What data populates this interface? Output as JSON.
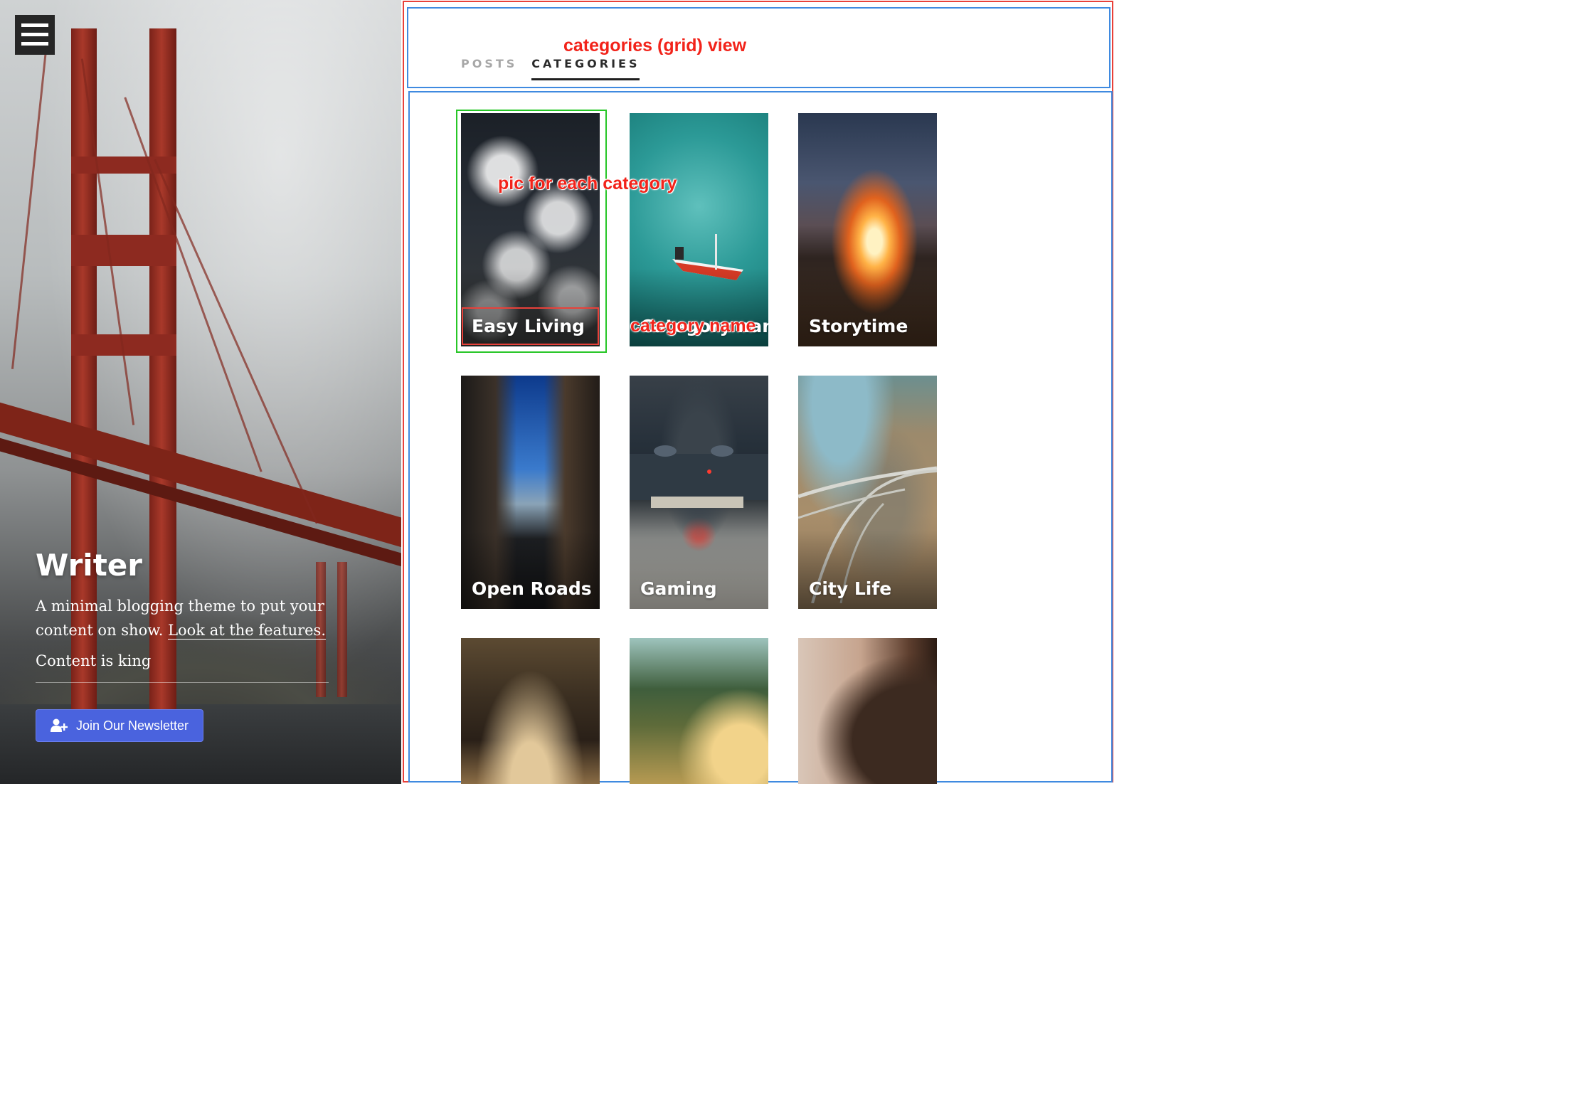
{
  "hero": {
    "title": "Writer",
    "description": "A minimal blogging theme to put your content on show.",
    "features_link": "Look at the features.",
    "tagline": "Content is king",
    "newsletter_button": "Join Our Newsletter"
  },
  "tabs": [
    {
      "label": "POSTS",
      "active": false
    },
    {
      "label": "CATEGORIES",
      "active": true
    }
  ],
  "annotations": {
    "view": "categories (grid) view",
    "pic": "pic for each category",
    "name": "category name"
  },
  "categories": [
    {
      "name": "Easy Living"
    },
    {
      "name": "Category name"
    },
    {
      "name": "Storytime"
    },
    {
      "name": "Open Roads"
    },
    {
      "name": "Gaming"
    },
    {
      "name": "City Life"
    },
    {
      "name": ""
    },
    {
      "name": ""
    },
    {
      "name": ""
    }
  ],
  "colors": {
    "newsletter_button": "#4a63de",
    "annotation_red": "#f2231a",
    "frame_blue": "#3f8ae0",
    "frame_green": "#27c627"
  },
  "icons": {
    "menu": "hamburger-menu-icon",
    "newsletter": "user-plus-icon"
  }
}
